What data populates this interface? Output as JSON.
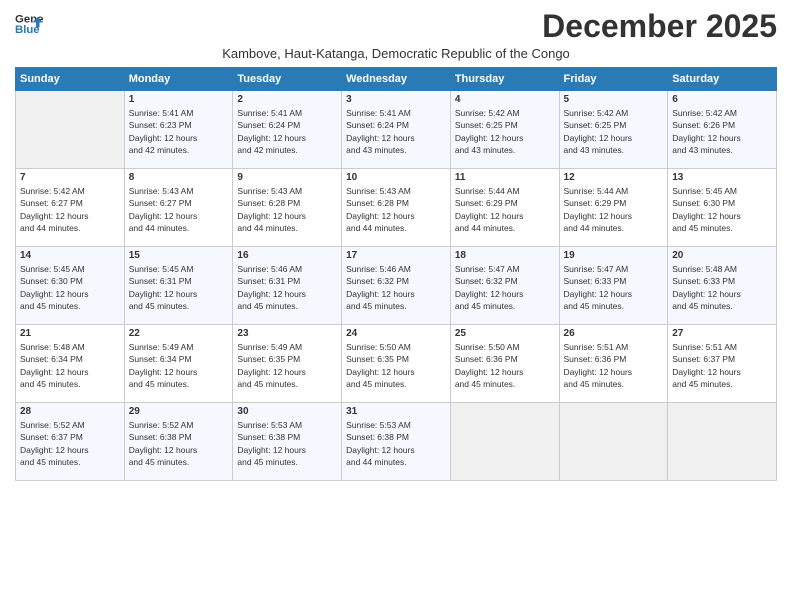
{
  "header": {
    "logo_line1": "General",
    "logo_line2": "Blue",
    "month": "December 2025",
    "subtitle": "Kambove, Haut-Katanga, Democratic Republic of the Congo"
  },
  "weekdays": [
    "Sunday",
    "Monday",
    "Tuesday",
    "Wednesday",
    "Thursday",
    "Friday",
    "Saturday"
  ],
  "weeks": [
    [
      {
        "day": "",
        "text": ""
      },
      {
        "day": "1",
        "text": "Sunrise: 5:41 AM\nSunset: 6:23 PM\nDaylight: 12 hours\nand 42 minutes."
      },
      {
        "day": "2",
        "text": "Sunrise: 5:41 AM\nSunset: 6:24 PM\nDaylight: 12 hours\nand 42 minutes."
      },
      {
        "day": "3",
        "text": "Sunrise: 5:41 AM\nSunset: 6:24 PM\nDaylight: 12 hours\nand 43 minutes."
      },
      {
        "day": "4",
        "text": "Sunrise: 5:42 AM\nSunset: 6:25 PM\nDaylight: 12 hours\nand 43 minutes."
      },
      {
        "day": "5",
        "text": "Sunrise: 5:42 AM\nSunset: 6:25 PM\nDaylight: 12 hours\nand 43 minutes."
      },
      {
        "day": "6",
        "text": "Sunrise: 5:42 AM\nSunset: 6:26 PM\nDaylight: 12 hours\nand 43 minutes."
      }
    ],
    [
      {
        "day": "7",
        "text": "Sunrise: 5:42 AM\nSunset: 6:27 PM\nDaylight: 12 hours\nand 44 minutes."
      },
      {
        "day": "8",
        "text": "Sunrise: 5:43 AM\nSunset: 6:27 PM\nDaylight: 12 hours\nand 44 minutes."
      },
      {
        "day": "9",
        "text": "Sunrise: 5:43 AM\nSunset: 6:28 PM\nDaylight: 12 hours\nand 44 minutes."
      },
      {
        "day": "10",
        "text": "Sunrise: 5:43 AM\nSunset: 6:28 PM\nDaylight: 12 hours\nand 44 minutes."
      },
      {
        "day": "11",
        "text": "Sunrise: 5:44 AM\nSunset: 6:29 PM\nDaylight: 12 hours\nand 44 minutes."
      },
      {
        "day": "12",
        "text": "Sunrise: 5:44 AM\nSunset: 6:29 PM\nDaylight: 12 hours\nand 44 minutes."
      },
      {
        "day": "13",
        "text": "Sunrise: 5:45 AM\nSunset: 6:30 PM\nDaylight: 12 hours\nand 45 minutes."
      }
    ],
    [
      {
        "day": "14",
        "text": "Sunrise: 5:45 AM\nSunset: 6:30 PM\nDaylight: 12 hours\nand 45 minutes."
      },
      {
        "day": "15",
        "text": "Sunrise: 5:45 AM\nSunset: 6:31 PM\nDaylight: 12 hours\nand 45 minutes."
      },
      {
        "day": "16",
        "text": "Sunrise: 5:46 AM\nSunset: 6:31 PM\nDaylight: 12 hours\nand 45 minutes."
      },
      {
        "day": "17",
        "text": "Sunrise: 5:46 AM\nSunset: 6:32 PM\nDaylight: 12 hours\nand 45 minutes."
      },
      {
        "day": "18",
        "text": "Sunrise: 5:47 AM\nSunset: 6:32 PM\nDaylight: 12 hours\nand 45 minutes."
      },
      {
        "day": "19",
        "text": "Sunrise: 5:47 AM\nSunset: 6:33 PM\nDaylight: 12 hours\nand 45 minutes."
      },
      {
        "day": "20",
        "text": "Sunrise: 5:48 AM\nSunset: 6:33 PM\nDaylight: 12 hours\nand 45 minutes."
      }
    ],
    [
      {
        "day": "21",
        "text": "Sunrise: 5:48 AM\nSunset: 6:34 PM\nDaylight: 12 hours\nand 45 minutes."
      },
      {
        "day": "22",
        "text": "Sunrise: 5:49 AM\nSunset: 6:34 PM\nDaylight: 12 hours\nand 45 minutes."
      },
      {
        "day": "23",
        "text": "Sunrise: 5:49 AM\nSunset: 6:35 PM\nDaylight: 12 hours\nand 45 minutes."
      },
      {
        "day": "24",
        "text": "Sunrise: 5:50 AM\nSunset: 6:35 PM\nDaylight: 12 hours\nand 45 minutes."
      },
      {
        "day": "25",
        "text": "Sunrise: 5:50 AM\nSunset: 6:36 PM\nDaylight: 12 hours\nand 45 minutes."
      },
      {
        "day": "26",
        "text": "Sunrise: 5:51 AM\nSunset: 6:36 PM\nDaylight: 12 hours\nand 45 minutes."
      },
      {
        "day": "27",
        "text": "Sunrise: 5:51 AM\nSunset: 6:37 PM\nDaylight: 12 hours\nand 45 minutes."
      }
    ],
    [
      {
        "day": "28",
        "text": "Sunrise: 5:52 AM\nSunset: 6:37 PM\nDaylight: 12 hours\nand 45 minutes."
      },
      {
        "day": "29",
        "text": "Sunrise: 5:52 AM\nSunset: 6:38 PM\nDaylight: 12 hours\nand 45 minutes."
      },
      {
        "day": "30",
        "text": "Sunrise: 5:53 AM\nSunset: 6:38 PM\nDaylight: 12 hours\nand 45 minutes."
      },
      {
        "day": "31",
        "text": "Sunrise: 5:53 AM\nSunset: 6:38 PM\nDaylight: 12 hours\nand 44 minutes."
      },
      {
        "day": "",
        "text": ""
      },
      {
        "day": "",
        "text": ""
      },
      {
        "day": "",
        "text": ""
      }
    ]
  ]
}
